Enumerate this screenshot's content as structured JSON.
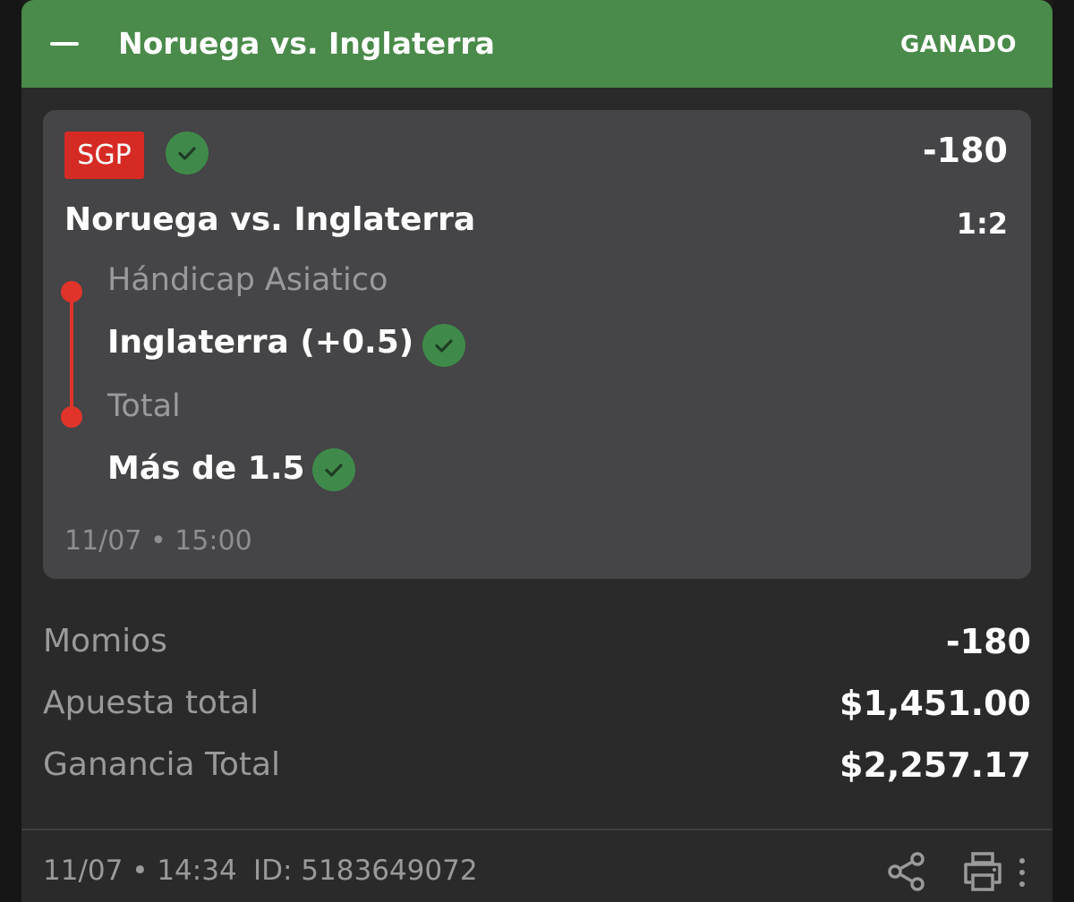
{
  "header": {
    "title": "Noruega vs. Inglaterra",
    "status": "GANADO",
    "status_color": "#4a8a4a"
  },
  "card": {
    "badge": "SGP",
    "badge_color": "#d52b24",
    "odds": "-180",
    "match": "Noruega vs. Inglaterra",
    "score": "1:2",
    "legs": [
      {
        "market": "Hándicap Asiatico",
        "selection": "Inglaterra (+0.5)",
        "icon": "check-icon"
      },
      {
        "market": "Total",
        "selection": "Más de 1.5",
        "icon": "check-icon"
      }
    ],
    "date": "11/07 • 15:00"
  },
  "summary": {
    "odds_label": "Momios",
    "odds_value": "-180",
    "stake_label": "Apuesta total",
    "stake_value": "$1,451.00",
    "payout_label": "Ganancia Total",
    "payout_value": "$2,257.17"
  },
  "footer": {
    "datetime": "11/07 • 14:34",
    "id": "ID: 5183649072",
    "icons": [
      "share-icon",
      "print-icon",
      "more-icon"
    ]
  }
}
